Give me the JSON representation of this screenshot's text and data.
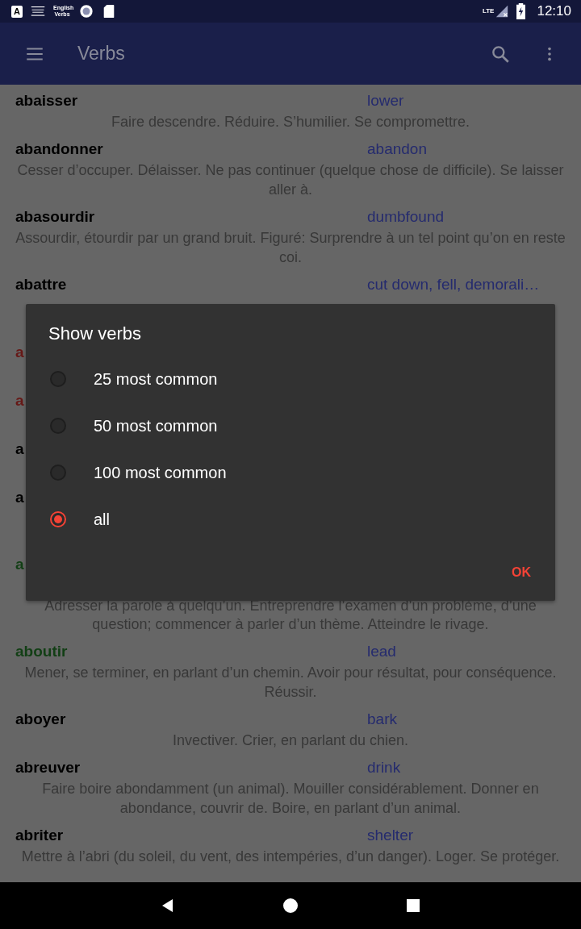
{
  "status_bar": {
    "notifications": [
      {
        "kind": "letter",
        "text": "A"
      },
      {
        "kind": "lines"
      },
      {
        "kind": "label",
        "text": "English Verbs"
      },
      {
        "kind": "ring"
      },
      {
        "kind": "card"
      }
    ],
    "network": "LTE",
    "time": "12:10"
  },
  "app_bar": {
    "title": "Verbs"
  },
  "verbs": [
    {
      "kind": "full",
      "headword": "abaisser",
      "color": "#000000",
      "translation": "lower",
      "definition": "Faire descendre. Réduire. S’humilier. Se compromettre."
    },
    {
      "kind": "full",
      "headword": "abandonner",
      "color": "#000000",
      "translation": "abandon",
      "definition": "Cesser d’occuper. Délaisser. Ne pas continuer (quelque chose de difficile). Se laisser aller à."
    },
    {
      "kind": "full",
      "headword": "abasourdir",
      "color": "#000000",
      "translation": "dumbfound",
      "definition": "Assourdir, étourdir par un grand bruit. Figuré: Surprendre à un tel point qu’on en reste coi."
    },
    {
      "kind": "cut",
      "headword": "abattre",
      "color": "#000000",
      "translation": "cut down, fell, demorali…"
    },
    {
      "kind": "covered",
      "headword": "a",
      "color": "#661816"
    },
    {
      "kind": "covered",
      "headword": "a",
      "color": "#661816"
    },
    {
      "kind": "covered",
      "headword": "a",
      "color": "#000000"
    },
    {
      "kind": "covered-tall",
      "headword": "a",
      "color": "#000000"
    },
    {
      "kind": "partial",
      "headword": "a",
      "color": "#123f15",
      "definition": "Adresser la parole à quelqu’un. Entreprendre l’examen d’un problème, d’une question; commencer à parler d’un thème. Atteindre le rivage."
    },
    {
      "kind": "full",
      "headword": "aboutir",
      "color": "#123f15",
      "translation": "lead",
      "definition": "Mener, se terminer, en parlant d’un chemin. Avoir pour résultat, pour conséquence. Réussir."
    },
    {
      "kind": "full",
      "headword": "aboyer",
      "color": "#000000",
      "translation": "bark",
      "definition": "Invectiver. Crier, en parlant du chien."
    },
    {
      "kind": "full",
      "headword": "abreuver",
      "color": "#000000",
      "translation": "drink",
      "definition": "Faire boire abondamment (un animal). Mouiller considérablement. Donner en abondance, couvrir de. Boire, en parlant d’un animal."
    },
    {
      "kind": "full",
      "headword": "abriter",
      "color": "#000000",
      "translation": "shelter",
      "definition": "Mettre à l’abri (du soleil, du vent, des intempéries, d’un danger). Loger. Se protéger."
    }
  ],
  "dialog": {
    "title": "Show verbs",
    "options": [
      {
        "label": "25 most common",
        "selected": false
      },
      {
        "label": "50 most common",
        "selected": false
      },
      {
        "label": "100 most common",
        "selected": false
      },
      {
        "label": "all",
        "selected": true
      }
    ],
    "button": "OK"
  }
}
